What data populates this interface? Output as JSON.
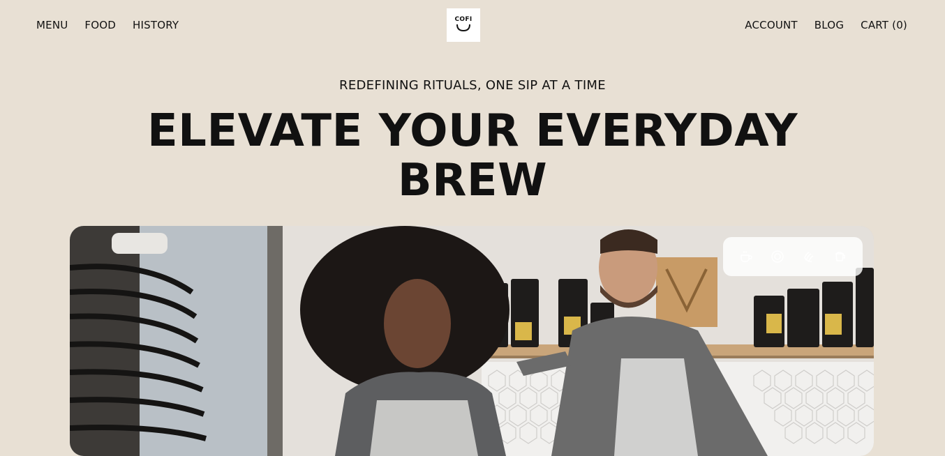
{
  "nav": {
    "left": [
      "MENU",
      "FOOD",
      "HISTORY"
    ],
    "right": [
      "ACCOUNT",
      "BLOG",
      "CART (0)"
    ],
    "logo_text": "COFI"
  },
  "hero": {
    "tagline": "REDEFINING RITUALS, ONE SIP AT A TIME",
    "headline_line1": "ELEVATE YOUR EVERYDAY",
    "headline_line2": "BREW"
  },
  "icon_panel": {
    "icons": [
      "coffee-cup-icon",
      "target-icon",
      "hand-icon",
      "coffee-pot-icon"
    ]
  },
  "colors": {
    "background": "#e8e0d4",
    "text": "#111111",
    "panel": "#ffffff"
  }
}
